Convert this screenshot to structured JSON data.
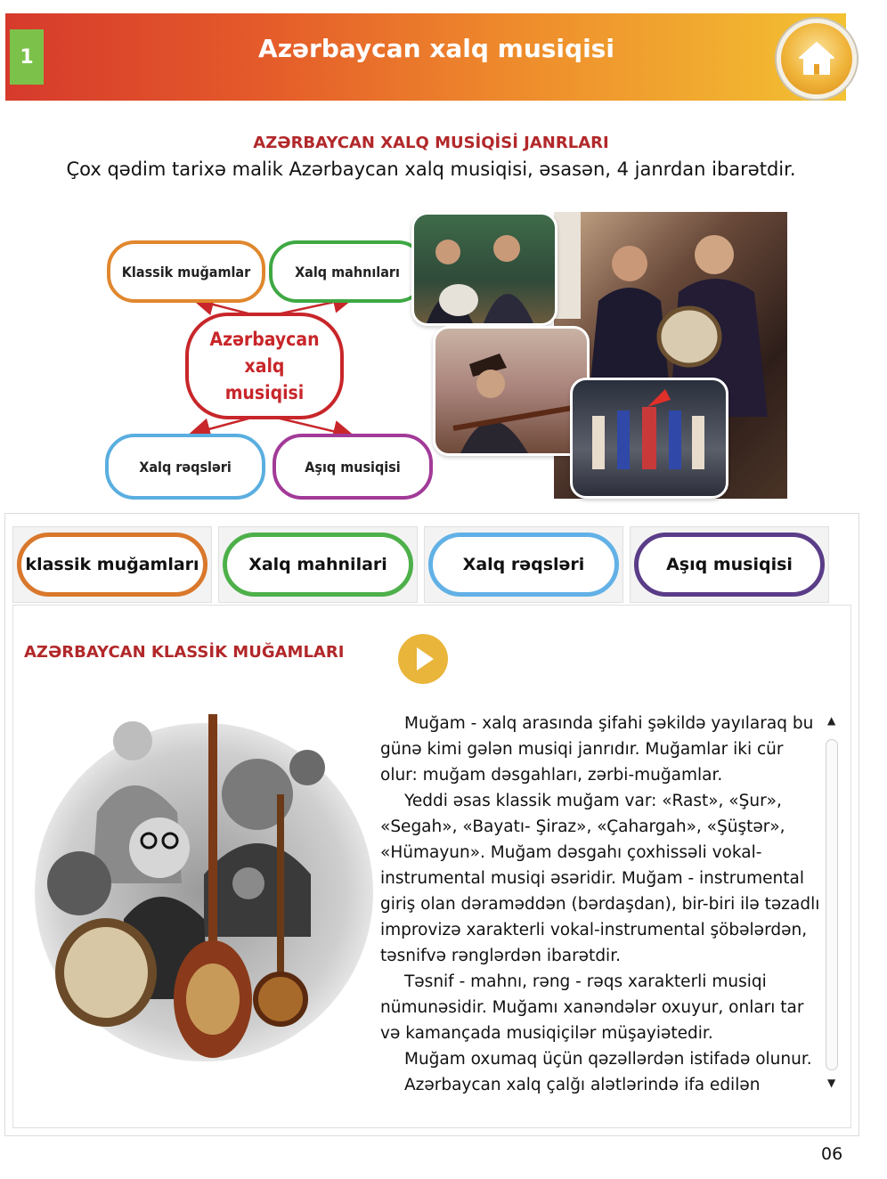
{
  "header": {
    "chapter": "1",
    "title": "Azərbaycan xalq musiqisi"
  },
  "genres_title": "AZƏRBAYCAN XALQ MUSİQİSİ JANRLARI",
  "intro": "Çox qədim tarixə malik Azərbaycan xalq musiqisi, əsasən, 4 janrdan ibarətdir.",
  "diagram": {
    "center": "Azərbaycan xalq musiqisi",
    "nodes": [
      "Klassik muğamlar",
      "Xalq mahnıları",
      "Xalq rəqsləri",
      "Aşıq musiqisi"
    ],
    "colors": {
      "red": "#c8262a",
      "orange": "#e0872e",
      "green": "#3ea843",
      "blue": "#5aaee0",
      "purple": "#a23a98"
    }
  },
  "tabs": [
    {
      "label": "klassik muğamları",
      "color": "#d9782c"
    },
    {
      "label": "Xalq mahnilari",
      "color": "#4db04a"
    },
    {
      "label": "Xalq rəqsləri",
      "color": "#62b1e6"
    },
    {
      "label": "Aşıq musiqisi",
      "color": "#5a3c88"
    }
  ],
  "section": {
    "title": "AZƏRBAYCAN KLASSİK MUĞAMLARI",
    "paragraphs": [
      "Muğam - xalq arasında şifahi şəkildə yayılaraq bu günə kimi gələn musiqi janrıdır. Muğamlar iki cür olur: muğam dəsgahları, zərbi-muğamlar.",
      "Yeddi əsas klassik muğam var: «Rast», «Şur», «Segah», «Bayatı- Şiraz», «Çahargah», «Şüştər», «Hümayun». Muğam dəsgahı çoxhissəli vokal-instrumental musiqi əsəridir. Muğam - instrumental giriş olan dəraməddən (bərdaşdan), bir-biri ilə təzadlı improvizə xarakterli vokal-instrumental şöbələrdən, təsnifvə rənglərdən ibarətdir.",
      "Təsnif - mahnı, rəng - rəqs xarakterli musiqi nümunəsidir. Muğamı xanəndələr oxuyur, onları tar və kamançada musiqiçilər müşayiətedir.",
      "Muğam oxumaq üçün qəzəllərdən istifadə olunur.",
      "Azərbaycan xalq çalğı alətlərində ifa edilən"
    ]
  },
  "page_number": "06"
}
